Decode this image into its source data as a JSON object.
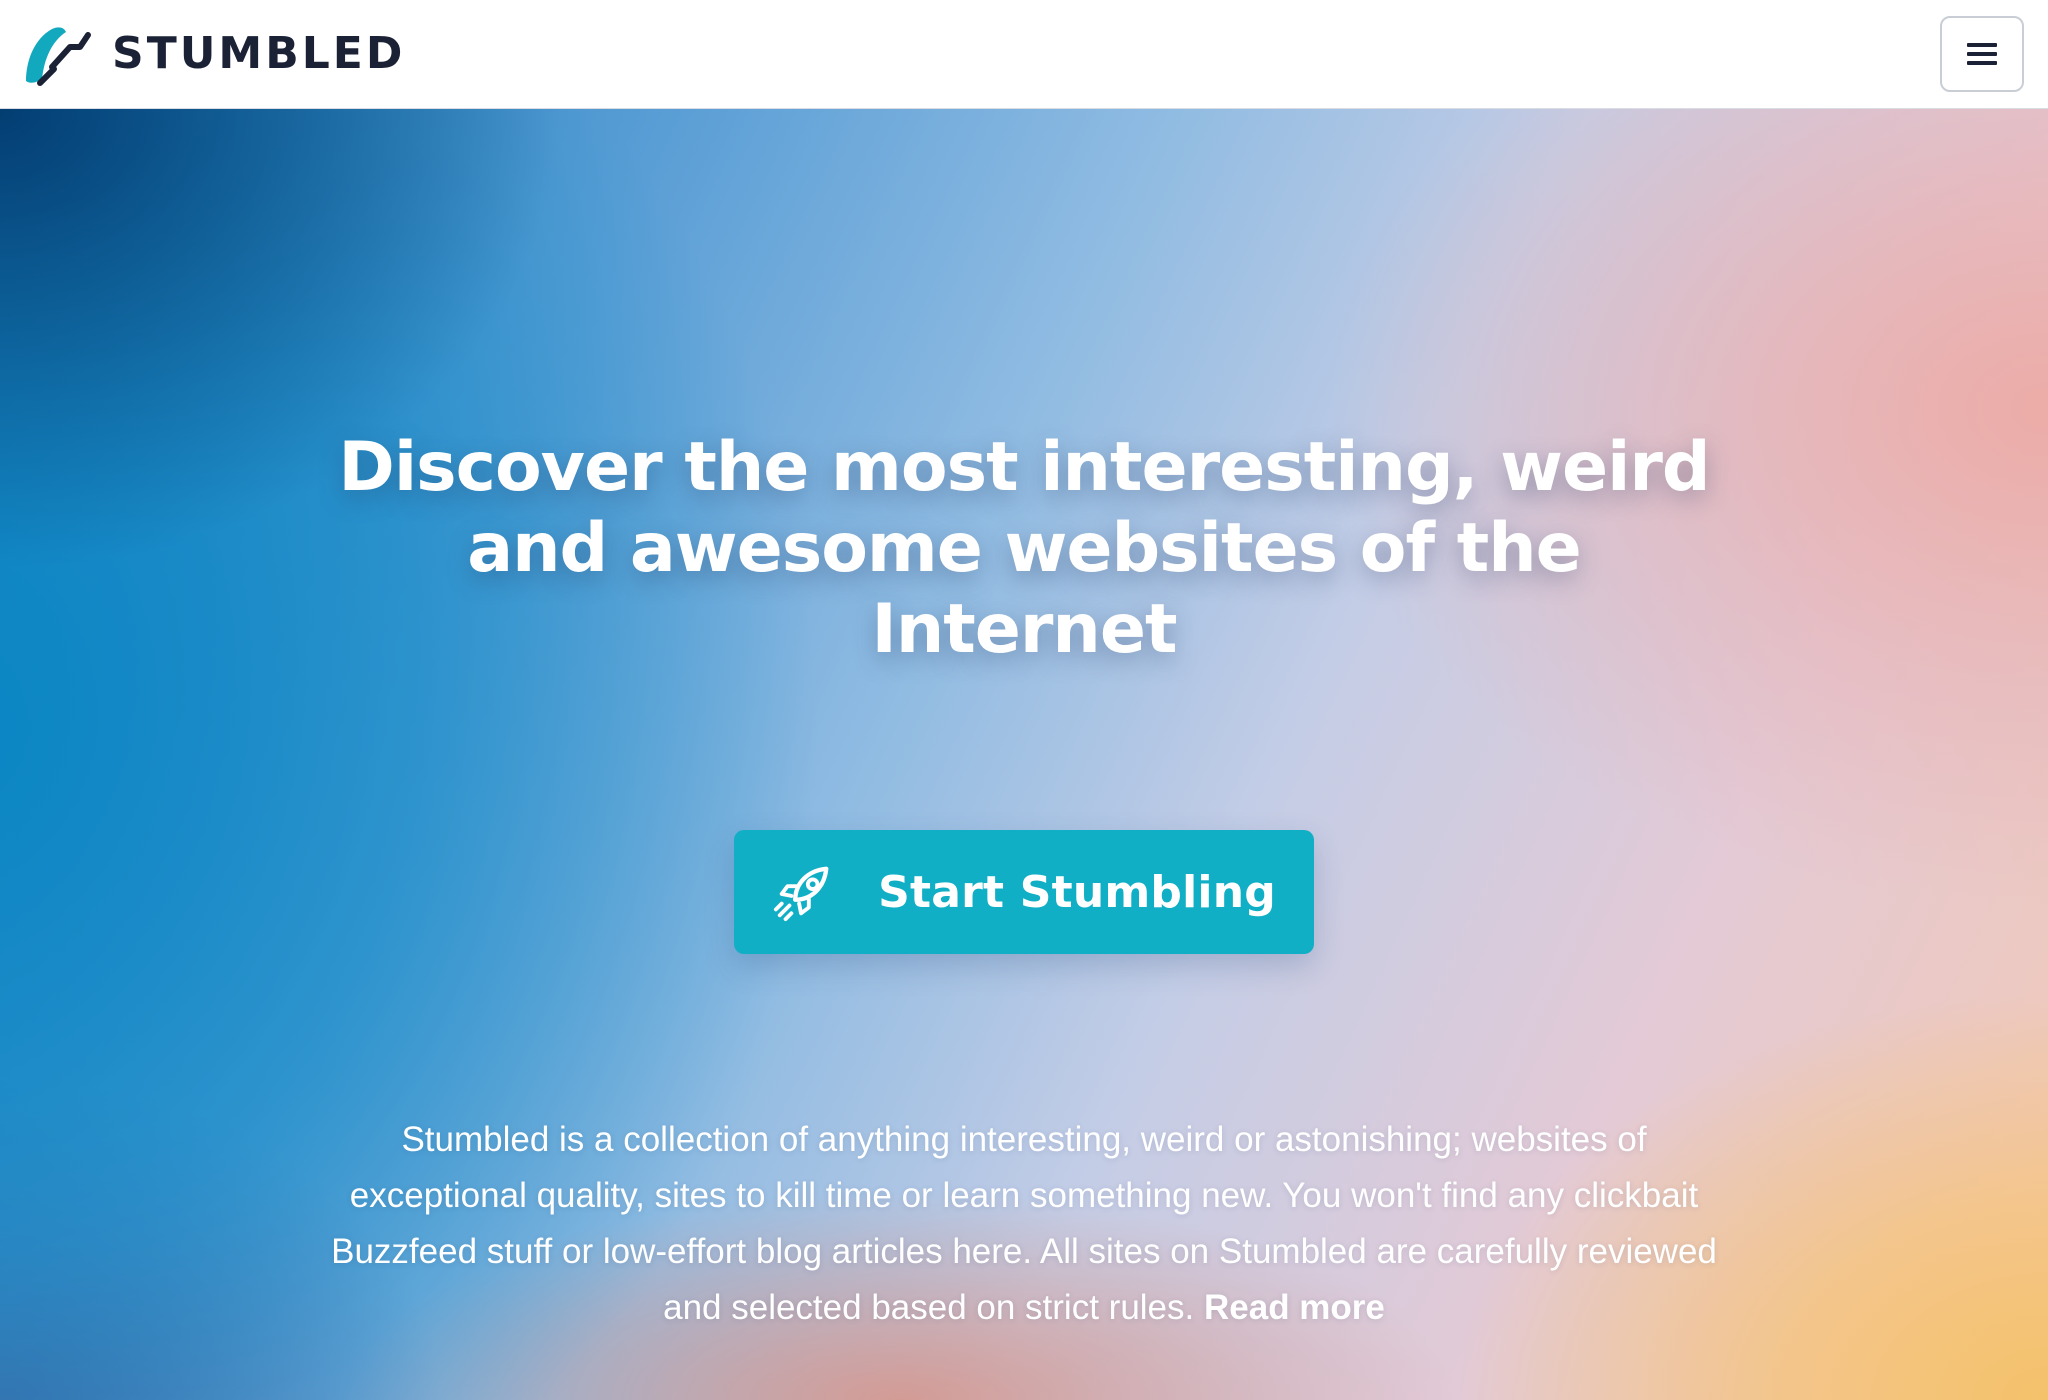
{
  "brand": {
    "name": "STUMBLED",
    "logo_icon": "stumbled-swoosh-logo",
    "accent_color": "#11afc5",
    "text_color": "#1b2235"
  },
  "navbar": {
    "menu_icon": "hamburger-menu-icon"
  },
  "hero": {
    "headline": "Discover the most interesting, weird and awesome websites of the Internet",
    "cta": {
      "label": "Start Stumbling",
      "icon": "rocket-icon",
      "color": "#11afc5"
    },
    "description": "Stumbled is a collection of anything interesting, weird or astonishing; websites of exceptional quality, sites to kill time or learn something new. You won't find any clickbait Buzzfeed stuff or low-effort blog articles here. All sites on Stumbled are carefully reviewed and selected based on strict rules.",
    "read_more": "Read more"
  }
}
